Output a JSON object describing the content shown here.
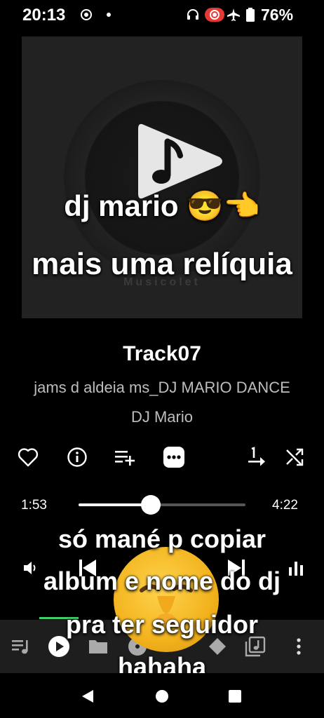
{
  "status_bar": {
    "time": "20:13",
    "battery": "76%",
    "icons": [
      "gps-icon",
      "dot-icon",
      "headphones-icon",
      "record-icon",
      "airplane-icon",
      "battery-icon"
    ]
  },
  "album_art": {
    "watermark": "Musicolet"
  },
  "overlay": {
    "line1": "dj mario 😎👈",
    "line2": "mais uma relíquia",
    "line3": "só mané p copiar",
    "line4": "album e nome do dj",
    "line5": "pra ter seguidor",
    "line6": "hahaha"
  },
  "track": {
    "title": "Track07",
    "album": "jams d aldeia ms_DJ MARIO DANCE",
    "artist": "DJ Mario"
  },
  "actions": [
    "heart-icon",
    "info-icon",
    "playlist-add-icon",
    "more-icon",
    "repeat-one-icon",
    "shuffle-icon"
  ],
  "progress": {
    "current": "1:53",
    "duration": "4:22",
    "fraction": 0.431
  },
  "colors": {
    "accent": "#3ecf6a",
    "background": "#000000",
    "tab_bar": "#1e1e1e",
    "record_badge": "#e53935"
  }
}
